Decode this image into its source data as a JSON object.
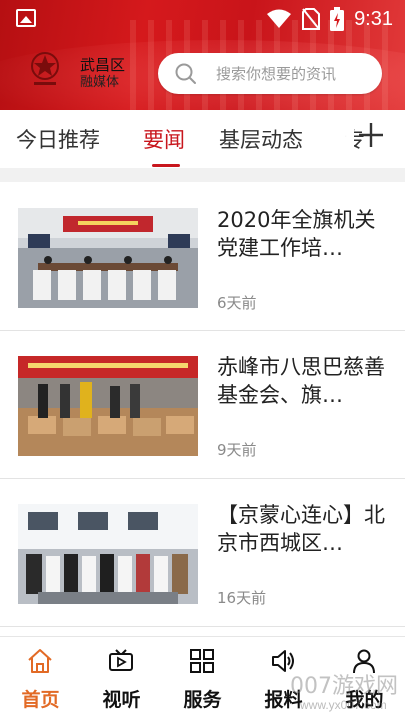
{
  "status_bar": {
    "time": "9:31"
  },
  "header": {
    "district_name": "武昌区",
    "district_sub": "融媒体",
    "search_placeholder": "搜索你想要的资讯"
  },
  "tabs": [
    {
      "label": "今日推荐",
      "active": false
    },
    {
      "label": "要闻",
      "active": true
    },
    {
      "label": "基层动态",
      "active": false
    },
    {
      "label": "专",
      "active": false
    }
  ],
  "news": [
    {
      "title": "2020年全旗机关党建工作培…",
      "time": "6天前"
    },
    {
      "title": "赤峰市八思巴慈善基金会、旗…",
      "time": "9天前"
    },
    {
      "title": "【京蒙心连心】北京市西城区…",
      "time": "16天前"
    }
  ],
  "bottom_nav": [
    {
      "label": "首页",
      "icon": "home-icon",
      "active": true
    },
    {
      "label": "视听",
      "icon": "video-icon",
      "active": false
    },
    {
      "label": "服务",
      "icon": "grid-icon",
      "active": false
    },
    {
      "label": "报料",
      "icon": "speaker-icon",
      "active": false
    },
    {
      "label": "我的",
      "icon": "user-icon",
      "active": false
    }
  ],
  "watermark": {
    "text": "007游戏网",
    "url": "www.yx007.com"
  },
  "colors": {
    "accent": "#c8161d",
    "nav_active": "#e26a25",
    "header_red": "#d5191c"
  }
}
